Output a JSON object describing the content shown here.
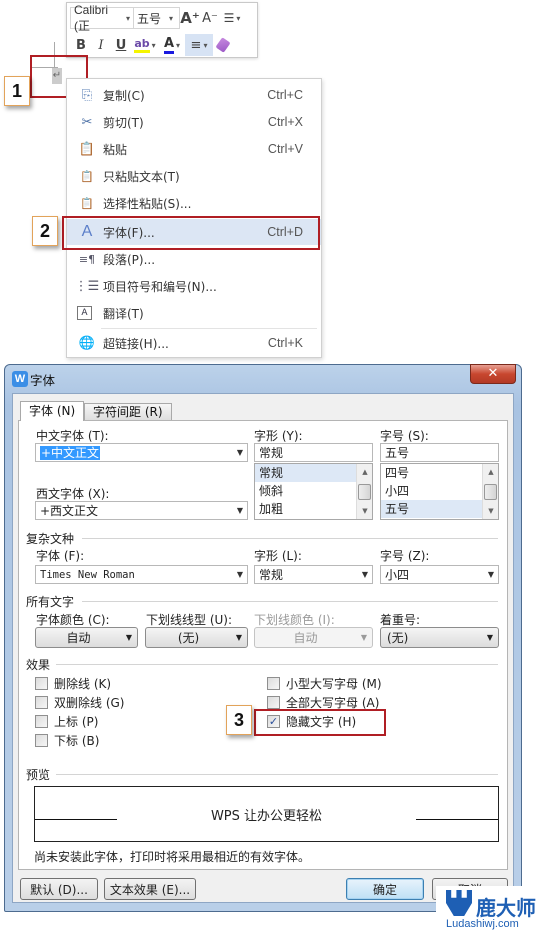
{
  "mini_toolbar": {
    "font_name": "Calibri (正",
    "font_size": "五号",
    "grow_icon": "A⁺",
    "shrink_icon": "A⁻",
    "line_spacing_icon": "line-spacing-icon",
    "bold": "B",
    "italic": "I",
    "underline": "U",
    "highlight": "ab",
    "font_color": "A",
    "align": "≡",
    "format_painter": "format-painter-icon",
    "colors": {
      "highlight": "#f5f500",
      "font_color": "#1a1adf"
    }
  },
  "paragraph_mark": "↵",
  "step_badges": [
    "1",
    "2",
    "3"
  ],
  "context_menu": {
    "items": [
      {
        "label": "复制(C)",
        "shortcut": "Ctrl+C",
        "icon": "copy-icon"
      },
      {
        "label": "剪切(T)",
        "shortcut": "Ctrl+X",
        "icon": "cut-icon"
      },
      {
        "label": "粘贴",
        "shortcut": "Ctrl+V",
        "icon": "paste-icon"
      },
      {
        "label": "只粘贴文本(T)",
        "shortcut": "",
        "icon": "paste-text-icon"
      },
      {
        "label": "选择性粘贴(S)...",
        "shortcut": "",
        "icon": "paste-special-icon"
      },
      {
        "label": "字体(F)...",
        "shortcut": "Ctrl+D",
        "icon": "font-icon",
        "highlighted": true
      },
      {
        "label": "段落(P)...",
        "shortcut": "",
        "icon": "paragraph-icon"
      },
      {
        "label": "项目符号和编号(N)...",
        "shortcut": "",
        "icon": "bullets-icon"
      },
      {
        "label": "翻译(T)",
        "shortcut": "",
        "icon": "translate-icon"
      },
      {
        "label": "超链接(H)...",
        "shortcut": "Ctrl+K",
        "icon": "hyperlink-icon"
      }
    ]
  },
  "dialog": {
    "title": "字体",
    "close": "✕",
    "tabs": [
      "字体 (N)",
      "字符间距 (R)"
    ],
    "chinese_font_label": "中文字体 (T):",
    "chinese_font_value": "+中文正文",
    "western_font_label": "西文字体 (X):",
    "western_font_value": "+西文正文",
    "style_label": "字形 (Y):",
    "style_value": "常规",
    "style_options": [
      "常规",
      "倾斜",
      "加粗"
    ],
    "size_label": "字号 (S):",
    "size_value": "五号",
    "size_options": [
      "四号",
      "小四",
      "五号"
    ],
    "complex_group": "复杂文种",
    "complex_font_label": "字体 (F):",
    "complex_font_value": "Times New Roman",
    "complex_style_label": "字形 (L):",
    "complex_style_value": "常规",
    "complex_size_label": "字号 (Z):",
    "complex_size_value": "小四",
    "all_text_group": "所有文字",
    "font_color_label": "字体颜色 (C):",
    "font_color_value": "自动",
    "underline_type_label": "下划线线型 (U):",
    "underline_type_value": "(无)",
    "underline_color_label": "下划线颜色 (I):",
    "underline_color_value": "自动",
    "emphasis_label": "着重号:",
    "emphasis_value": "(无)",
    "effects_group": "效果",
    "effects": [
      {
        "label": "删除线 (K)",
        "checked": false
      },
      {
        "label": "双删除线 (G)",
        "checked": false
      },
      {
        "label": "上标 (P)",
        "checked": false
      },
      {
        "label": "下标 (B)",
        "checked": false
      },
      {
        "label": "小型大写字母 (M)",
        "checked": false
      },
      {
        "label": "全部大写字母 (A)",
        "checked": false
      },
      {
        "label": "隐藏文字 (H)",
        "checked": true
      }
    ],
    "preview_group": "预览",
    "preview_text": "WPS 让办公更轻松",
    "note": "尚未安装此字体，打印时将采用最相近的有效字体。",
    "default_button": "默认 (D)...",
    "text_effects_button": "文本效果 (E)...",
    "ok_button": "确定",
    "cancel_button": "取消"
  },
  "watermark": {
    "brand": "鹿大师",
    "site": "Ludashiwj.com",
    "color": "#1e5fb4"
  }
}
